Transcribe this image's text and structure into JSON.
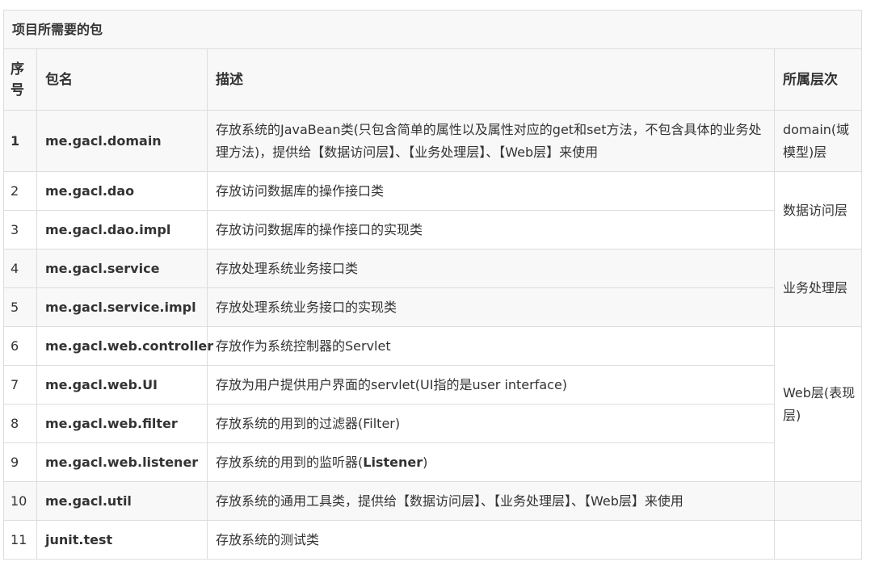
{
  "table": {
    "caption": "项目所需要的包",
    "headers": {
      "seq": "序号",
      "package": "包名",
      "description": "描述",
      "layer": "所属层次"
    },
    "rows": [
      {
        "num": "1",
        "package": "me.gacl.domain",
        "description": "存放系统的JavaBean类(只包含简单的属性以及属性对应的get和set方法，不包含具体的业务处理方法)，提供给【数据访问层】、【业务处理层】、【Web层】来使用"
      },
      {
        "num": "2",
        "package": "me.gacl.dao",
        "description": "存放访问数据库的操作接口类"
      },
      {
        "num": "3",
        "package": "me.gacl.dao.impl",
        "description": "存放访问数据库的操作接口的实现类"
      },
      {
        "num": "4",
        "package": "me.gacl.service",
        "description": "存放处理系统业务接口类"
      },
      {
        "num": "5",
        "package": "me.gacl.service.impl",
        "description": "存放处理系统业务接口的实现类"
      },
      {
        "num": "6",
        "package": "me.gacl.web.controller",
        "description": "存放作为系统控制器的Servlet"
      },
      {
        "num": "7",
        "package": "me.gacl.web.UI",
        "description": "存放为用户提供用户界面的servlet(UI指的是user interface)"
      },
      {
        "num": "8",
        "package": "me.gacl.web.filter",
        "description": "存放系统的用到的过滤器(Filter)"
      },
      {
        "num": "9",
        "package": "me.gacl.web.listener",
        "description_prefix": "存放系统的用到的监听器(",
        "description_bold": "Listener",
        "description_suffix": ")"
      },
      {
        "num": "10",
        "package": "me.gacl.util",
        "description": "存放系统的通用工具类，提供给【数据访问层】、【业务处理层】、【Web层】来使用"
      },
      {
        "num": "11",
        "package": "junit.test",
        "description": "存放系统的测试类"
      }
    ],
    "layers": {
      "domain": " domain(域模型)层",
      "dao": "数据访问层",
      "service": "业务处理层",
      "web": "Web层(表现层)",
      "util": "",
      "test": ""
    }
  }
}
